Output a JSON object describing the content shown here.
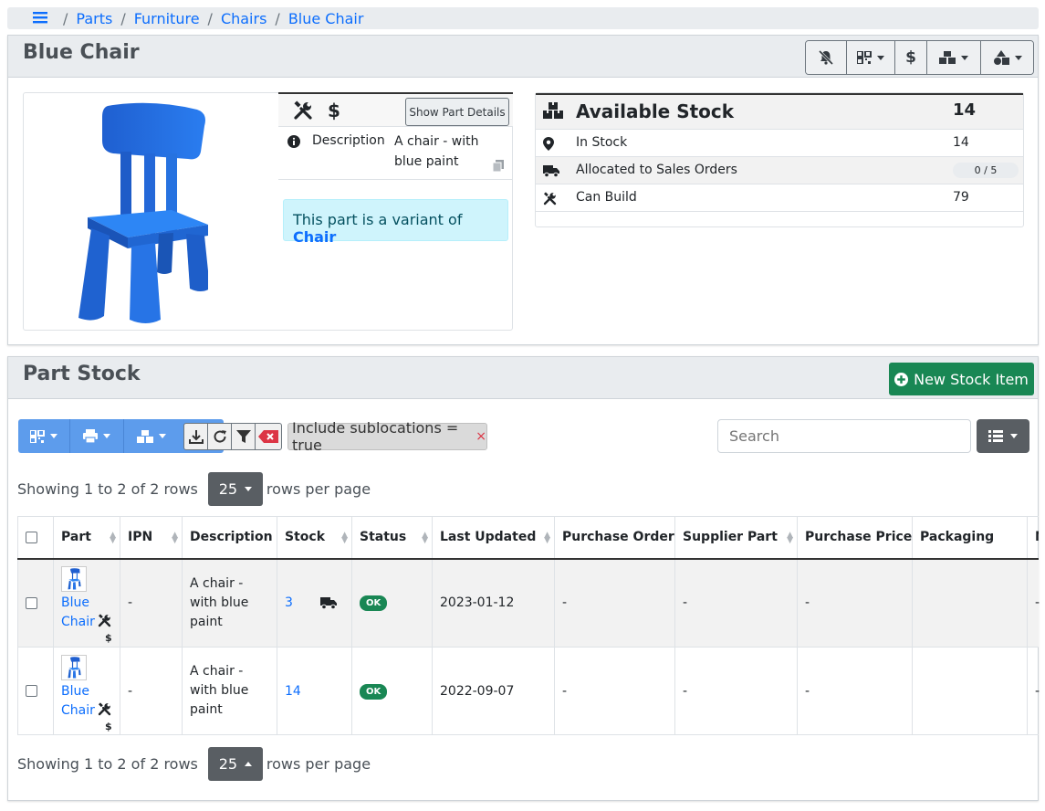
{
  "breadcrumb": {
    "items": [
      "Parts",
      "Furniture",
      "Chairs",
      "Blue Chair"
    ]
  },
  "part": {
    "title": "Blue Chair",
    "show_details_label": "Show Part Details",
    "description_label": "Description",
    "description_value": "A chair - with blue paint",
    "variant_prefix": "This part is a variant of ",
    "variant_link": "Chair",
    "image_icon": "chair-image"
  },
  "stock_summary": {
    "available_label": "Available Stock",
    "available_value": "14",
    "in_stock_label": "In Stock",
    "in_stock_value": "14",
    "allocated_label": "Allocated to Sales Orders",
    "allocated_value": "0 / 5",
    "can_build_label": "Can Build",
    "can_build_value": "79"
  },
  "stock_panel": {
    "title": "Part Stock",
    "new_button": "New Stock Item",
    "filter_chip": "Include sublocations = true",
    "filter_chip_remove": "×",
    "search_placeholder": "Search",
    "pagination_text": "Showing 1 to 2 of 2 rows",
    "rows_per_page_value": "25",
    "rows_per_page_label": "rows per page"
  },
  "table": {
    "columns": [
      "Part",
      "IPN",
      "Description",
      "Stock",
      "Status",
      "Last Updated",
      "Purchase Order",
      "Supplier Part",
      "Purchase Price",
      "Packaging",
      "No"
    ],
    "rows": [
      {
        "part": "Blue Chair",
        "dollar": "$",
        "ipn": "-",
        "description": "A chair - with blue paint",
        "stock": "3",
        "status": "OK",
        "last_updated": "2023-01-12",
        "purchase_order": "-",
        "supplier_part": "-",
        "purchase_price": "-",
        "packaging": "",
        "notes": "-"
      },
      {
        "part": "Blue Chair",
        "dollar": "$",
        "ipn": "-",
        "description": "A chair - with blue paint",
        "stock": "14",
        "status": "OK",
        "last_updated": "2022-09-07",
        "purchase_order": "-",
        "supplier_part": "-",
        "purchase_price": "-",
        "packaging": "",
        "notes": "-"
      }
    ]
  },
  "colors": {
    "link": "#0d6efd",
    "success": "#198754",
    "toolbar_blue": "#5d9cec",
    "info_bg": "#cff4fc",
    "panel_header": "#e9ecef"
  }
}
